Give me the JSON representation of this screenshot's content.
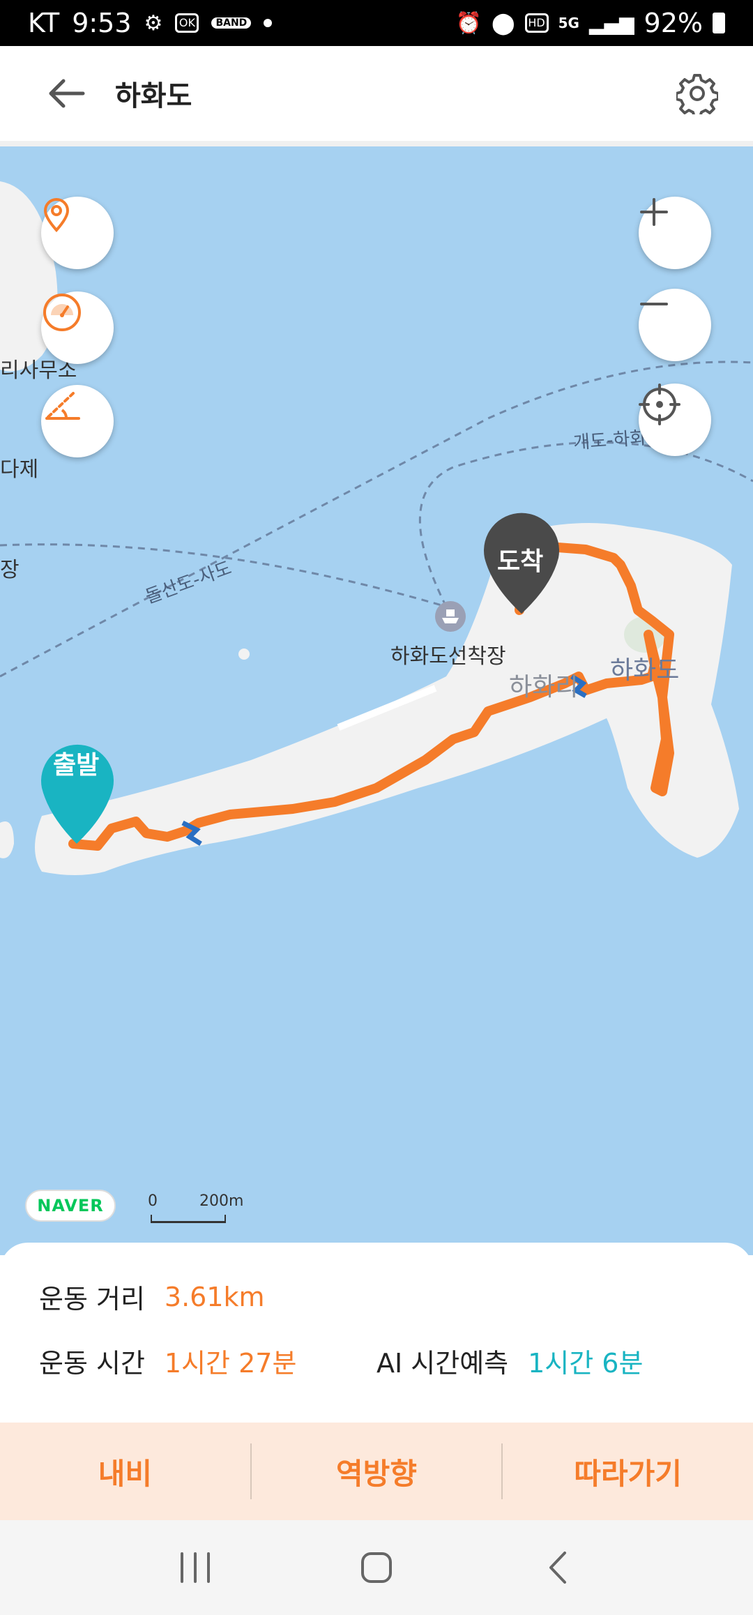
{
  "status_bar": {
    "carrier": "KT",
    "time": "9:53",
    "battery_pct": "92%",
    "network": "5G",
    "hd_label": "HD",
    "band_label": "BAND"
  },
  "header": {
    "title": "하화도"
  },
  "map": {
    "labels": {
      "office_partial": "리사무소",
      "partial_je": "다제",
      "partial_jang": "장",
      "route_dolsando": "돌산도-사도",
      "route_gaedo": "개도-하화도",
      "pier": "하화도선착장",
      "village": "하화리",
      "island": "하화도"
    },
    "markers": {
      "start": "출발",
      "end": "도착"
    },
    "attribution": "NAVER",
    "scale_start": "0",
    "scale_end": "200m",
    "colors": {
      "sea": "#a6d1f1",
      "land": "#f2f2f2",
      "route": "#f57c2a",
      "start_marker": "#19b4c2",
      "end_marker": "#4a4a4a"
    }
  },
  "stats": {
    "distance_label": "운동 거리",
    "distance_value": "3.61km",
    "time_label": "운동 시간",
    "time_value": "1시간 27분",
    "ai_label": "AI 시간예측",
    "ai_value": "1시간 6분"
  },
  "actions": {
    "navi": "내비",
    "reverse": "역방향",
    "follow": "따라가기"
  }
}
